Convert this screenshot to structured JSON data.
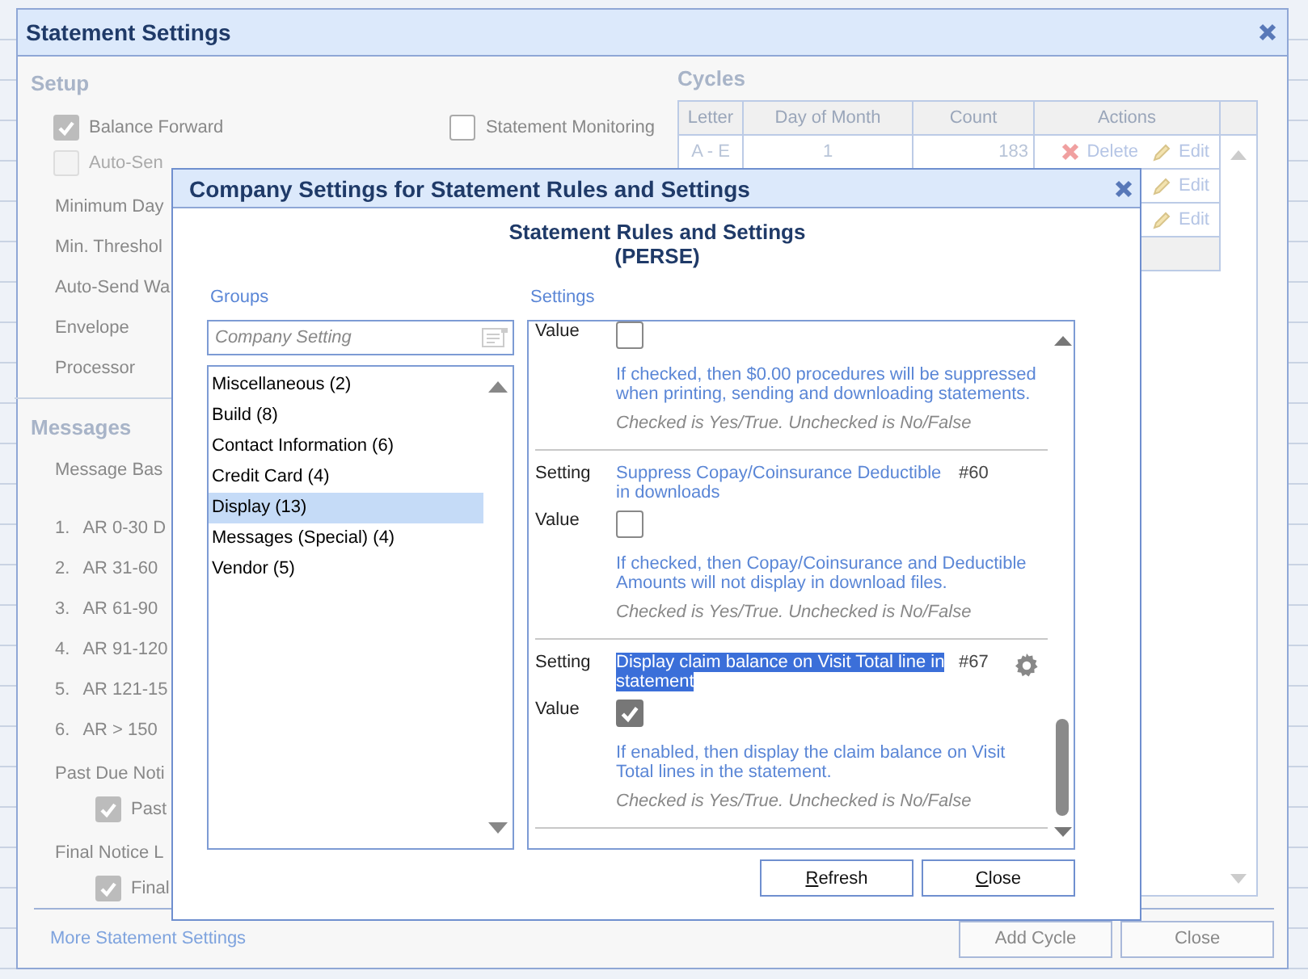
{
  "window": {
    "title": "Statement Settings"
  },
  "setup": {
    "heading": "Setup",
    "checkboxes": [
      {
        "label": "Balance Forward",
        "checked": true,
        "disabled": false
      },
      {
        "label": "Statement Monitoring",
        "checked": false,
        "disabled": false
      },
      {
        "label": "Auto-Sen",
        "checked": false,
        "disabled": true
      }
    ],
    "fields": [
      "Minimum Day",
      "Min. Threshol",
      "Auto-Send Wa",
      "Envelope",
      "Processor"
    ]
  },
  "messages": {
    "heading": "Messages",
    "label": "Message Bas",
    "list": [
      {
        "number": "1.",
        "text": "AR 0-30 D"
      },
      {
        "number": "2.",
        "text": "AR 31-60"
      },
      {
        "number": "3.",
        "text": "AR 61-90"
      },
      {
        "number": "4.",
        "text": "AR 91-120"
      },
      {
        "number": "5.",
        "text": "AR 121-15"
      },
      {
        "number": "6.",
        "text": "AR > 150"
      }
    ],
    "notices": [
      {
        "label": "Past Due Noti",
        "checkbox": {
          "label": "Past",
          "checked": true
        }
      },
      {
        "label": "Final Notice L",
        "checkbox": {
          "label": "Final",
          "checked": true
        }
      }
    ]
  },
  "more_link": "More Statement Settings",
  "cycles": {
    "heading": "Cycles",
    "columns": [
      "Letter",
      "Day of Month",
      "Count",
      "Actions"
    ],
    "rows": [
      {
        "letter": "A - E",
        "day": "1",
        "count": "183",
        "delete": "Delete",
        "edit": "Edit"
      },
      {
        "edit": "Edit"
      },
      {
        "edit": "Edit"
      }
    ]
  },
  "buttons": [
    "Add Cycle",
    "Close"
  ],
  "dialog": {
    "title": "Company Settings for Statement Rules and Settings",
    "heading": "Statement Rules and Settings",
    "subheading": "(PERSE)",
    "groups_label": "Groups",
    "settings_label": "Settings",
    "search": {
      "placeholder": "Company Setting"
    },
    "groups": [
      {
        "label": "Miscellaneous (2)",
        "selected": false
      },
      {
        "label": "Build (8)",
        "selected": false
      },
      {
        "label": "Contact Information (6)",
        "selected": false
      },
      {
        "label": "Credit Card (4)",
        "selected": false
      },
      {
        "label": "Display (13)",
        "selected": true
      },
      {
        "label": "Messages (Special) (4)",
        "selected": false
      },
      {
        "label": "Vendor (5)",
        "selected": false
      }
    ],
    "settings": [
      {
        "value_label": "Value",
        "checked": false,
        "description": "If checked, then $0.00 procedures will be suppressed when printing, sending and downloading statements.",
        "note": "Checked is Yes/True. Unchecked is No/False"
      },
      {
        "setting_label": "Setting",
        "name": "Suppress Copay/Coinsurance Deductible in downloads",
        "number": "#60",
        "highlighted": false,
        "gear": false,
        "value_label": "Value",
        "checked": false,
        "description": "If checked, then Copay/Coinsurance and Deductible Amounts will not display in download files.",
        "note": "Checked is Yes/True. Unchecked is No/False"
      },
      {
        "setting_label": "Setting",
        "name": "Display claim balance on Visit Total line in statement",
        "number": "#67",
        "highlighted": true,
        "gear": true,
        "value_label": "Value",
        "checked": true,
        "description": "If enabled, then display the claim balance on Visit Total lines in the statement.",
        "note": "Checked is Yes/True. Unchecked is No/False"
      }
    ],
    "buttons": [
      "Refresh",
      "Close"
    ]
  }
}
